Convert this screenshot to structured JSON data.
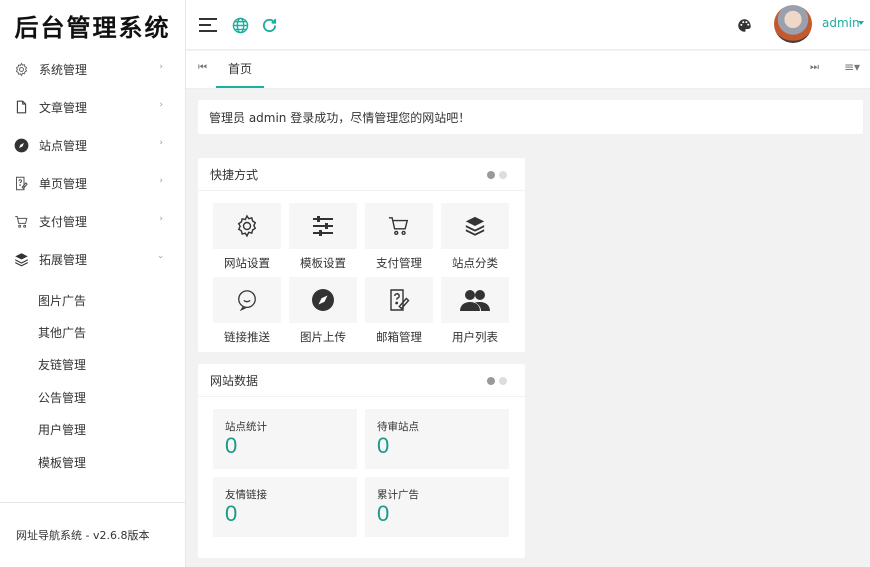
{
  "app": {
    "title": "后台管理系统"
  },
  "sidebar": {
    "items": [
      {
        "label": "系统管理",
        "icon": "gear-icon"
      },
      {
        "label": "文章管理",
        "icon": "file-icon"
      },
      {
        "label": "站点管理",
        "icon": "compass-icon"
      },
      {
        "label": "单页管理",
        "icon": "help-page-icon"
      },
      {
        "label": "支付管理",
        "icon": "cart-icon"
      },
      {
        "label": "拓展管理",
        "icon": "layers-icon"
      }
    ],
    "submenu": [
      "图片广告",
      "其他广告",
      "友链管理",
      "公告管理",
      "用户管理",
      "模板管理"
    ],
    "footer": "网址导航系统 - v2.6.8版本"
  },
  "header": {
    "user_name": "admin",
    "icons": [
      "menu-toggle-icon",
      "globe-icon",
      "refresh-icon",
      "palette-icon"
    ],
    "accent_color": "#1cae9e"
  },
  "tabs": {
    "home": "首页"
  },
  "notice": {
    "text": "管理员 admin 登录成功，尽情管理您的网站吧！"
  },
  "shortcuts": {
    "title": "快捷方式",
    "items": [
      {
        "label": "网站设置",
        "icon": "gear-icon"
      },
      {
        "label": "模板设置",
        "icon": "sliders-icon"
      },
      {
        "label": "支付管理",
        "icon": "cart-icon"
      },
      {
        "label": "站点分类",
        "icon": "layers-icon"
      },
      {
        "label": "链接推送",
        "icon": "chat-icon"
      },
      {
        "label": "图片上传",
        "icon": "compass-icon"
      },
      {
        "label": "邮箱管理",
        "icon": "help-page-icon"
      },
      {
        "label": "用户列表",
        "icon": "users-icon"
      }
    ]
  },
  "site_data": {
    "title": "网站数据",
    "stats": [
      {
        "label": "站点统计",
        "value": "0"
      },
      {
        "label": "待审站点",
        "value": "0"
      },
      {
        "label": "友情链接",
        "value": "0"
      },
      {
        "label": "累计广告",
        "value": "0"
      }
    ]
  }
}
